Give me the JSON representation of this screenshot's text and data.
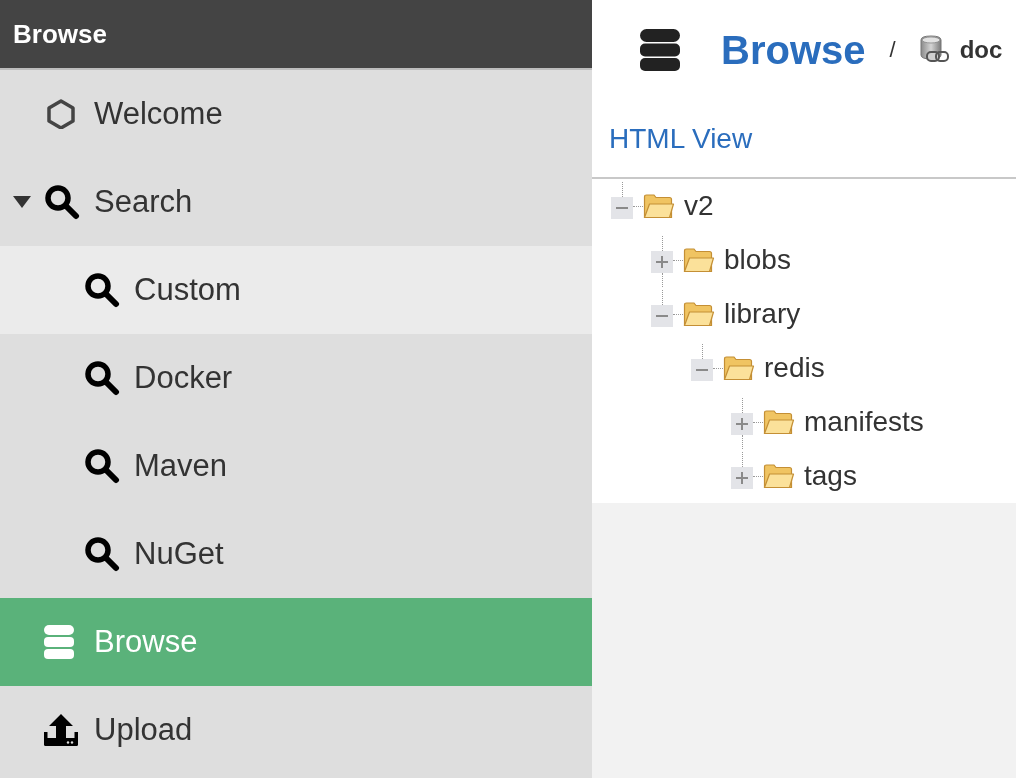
{
  "sidebar": {
    "title": "Browse",
    "items": [
      {
        "kind": "welcome",
        "label": "Welcome",
        "selected": false,
        "hovered": false
      },
      {
        "kind": "search",
        "label": "Search",
        "selected": false,
        "hovered": false,
        "expanded": true,
        "children": [
          {
            "kind": "search",
            "label": "Custom",
            "selected": false,
            "hovered": true
          },
          {
            "kind": "search",
            "label": "Docker",
            "selected": false,
            "hovered": false
          },
          {
            "kind": "search",
            "label": "Maven",
            "selected": false,
            "hovered": false
          },
          {
            "kind": "search",
            "label": "NuGet",
            "selected": false,
            "hovered": false
          }
        ]
      },
      {
        "kind": "browse",
        "label": "Browse",
        "selected": true,
        "hovered": false
      },
      {
        "kind": "upload",
        "label": "Upload",
        "selected": false,
        "hovered": false
      }
    ]
  },
  "page_header": {
    "title": "Browse",
    "separator": "/",
    "repository": "doc"
  },
  "view_link": "HTML View",
  "tree": [
    {
      "label": "v2",
      "expanded": true,
      "children": [
        {
          "label": "blobs",
          "expanded": false
        },
        {
          "label": "library",
          "expanded": true,
          "children": [
            {
              "label": "redis",
              "expanded": true,
              "children": [
                {
                  "label": "manifests",
                  "expanded": false
                },
                {
                  "label": "tags",
                  "expanded": false
                }
              ]
            }
          ]
        }
      ]
    }
  ]
}
